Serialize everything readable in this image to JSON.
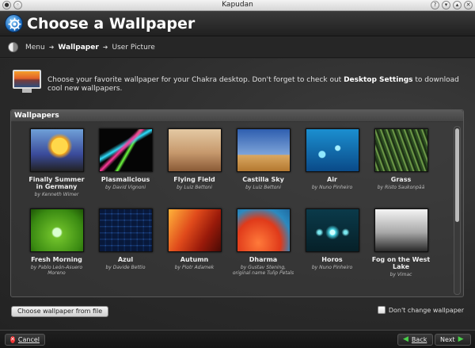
{
  "window": {
    "title": "Kapudan"
  },
  "header": {
    "title": "Choose a Wallpaper"
  },
  "breadcrumb": {
    "items": [
      "Menu",
      "Wallpaper",
      "User Picture"
    ]
  },
  "intro": {
    "text_before": "Choose your favorite wallpaper for your Chakra desktop. Don't forget to check out ",
    "link": "Desktop Settings",
    "text_after": " to download cool new wallpapers."
  },
  "panel": {
    "title": "Wallpapers"
  },
  "wallpapers": [
    {
      "name": "Finally Summer in Germany",
      "author": "by Kenneth Wimer",
      "thumb": "t-summer"
    },
    {
      "name": "Plasmalicious",
      "author": "by David Vignoni",
      "thumb": "t-plasma"
    },
    {
      "name": "Flying Field",
      "author": "by Luiz Bettoni",
      "thumb": "t-field"
    },
    {
      "name": "Castilla Sky",
      "author": "by Luiz Bettoni",
      "thumb": "t-castilla"
    },
    {
      "name": "Air",
      "author": "by Nuno Pinheiro",
      "thumb": "t-air"
    },
    {
      "name": "Grass",
      "author": "by Risto Saukonpää",
      "thumb": "t-grass"
    },
    {
      "name": "Fresh Morning",
      "author": "by Pablo León-Asuero Moreno",
      "thumb": "t-morning"
    },
    {
      "name": "Azul",
      "author": "by Davide Bettio",
      "thumb": "t-azul"
    },
    {
      "name": "Autumn",
      "author": "by Piotr Adamek",
      "thumb": "t-autumn"
    },
    {
      "name": "Dharma",
      "author": "by Gustav Stening, original name Tulip Petals",
      "thumb": "t-dharma"
    },
    {
      "name": "Horos",
      "author": "by Nuno Pinheiro",
      "thumb": "t-horos"
    },
    {
      "name": "Fog on the West Lake",
      "author": "by Vimac",
      "thumb": "t-fog"
    }
  ],
  "controls": {
    "file_button": "Choose wallpaper from file",
    "dont_change": "Don't change wallpaper"
  },
  "footer": {
    "cancel": "Cancel",
    "back": "Back",
    "next": "Next"
  }
}
